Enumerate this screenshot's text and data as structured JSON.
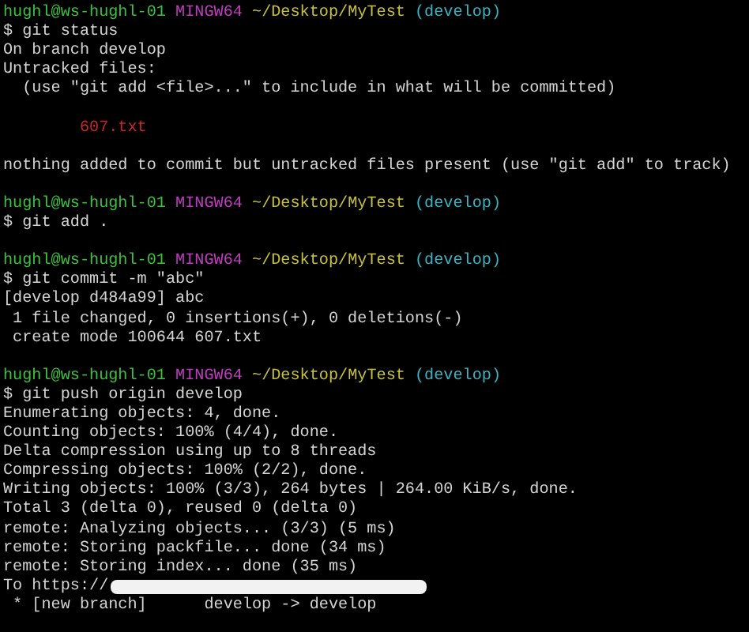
{
  "terminal": {
    "lines": [
      {
        "kind": "prompt",
        "user": "hughl@ws-hughl-01",
        "system": "MINGW64",
        "path": "~/Desktop/MyTest",
        "branch": "(develop)"
      },
      {
        "kind": "command",
        "text": "$ git status"
      },
      {
        "kind": "output",
        "text": "On branch develop"
      },
      {
        "kind": "output",
        "text": "Untracked files:"
      },
      {
        "kind": "output",
        "text": "  (use \"git add <file>...\" to include in what will be committed)"
      },
      {
        "kind": "blank"
      },
      {
        "kind": "file",
        "text": "        607.txt"
      },
      {
        "kind": "blank"
      },
      {
        "kind": "output",
        "text": "nothing added to commit but untracked files present (use \"git add\" to track)"
      },
      {
        "kind": "blank"
      },
      {
        "kind": "prompt",
        "user": "hughl@ws-hughl-01",
        "system": "MINGW64",
        "path": "~/Desktop/MyTest",
        "branch": "(develop)"
      },
      {
        "kind": "command",
        "text": "$ git add ."
      },
      {
        "kind": "blank"
      },
      {
        "kind": "prompt",
        "user": "hughl@ws-hughl-01",
        "system": "MINGW64",
        "path": "~/Desktop/MyTest",
        "branch": "(develop)"
      },
      {
        "kind": "command",
        "text": "$ git commit -m \"abc\""
      },
      {
        "kind": "output",
        "text": "[develop d484a99] abc"
      },
      {
        "kind": "output",
        "text": " 1 file changed, 0 insertions(+), 0 deletions(-)"
      },
      {
        "kind": "output",
        "text": " create mode 100644 607.txt"
      },
      {
        "kind": "blank"
      },
      {
        "kind": "prompt",
        "user": "hughl@ws-hughl-01",
        "system": "MINGW64",
        "path": "~/Desktop/MyTest",
        "branch": "(develop)"
      },
      {
        "kind": "command",
        "text": "$ git push origin develop"
      },
      {
        "kind": "output",
        "text": "Enumerating objects: 4, done."
      },
      {
        "kind": "output",
        "text": "Counting objects: 100% (4/4), done."
      },
      {
        "kind": "output",
        "text": "Delta compression using up to 8 threads"
      },
      {
        "kind": "output",
        "text": "Compressing objects: 100% (2/2), done."
      },
      {
        "kind": "output",
        "text": "Writing objects: 100% (3/3), 264 bytes | 264.00 KiB/s, done."
      },
      {
        "kind": "output",
        "text": "Total 3 (delta 0), reused 0 (delta 0)"
      },
      {
        "kind": "output",
        "text": "remote: Analyzing objects... (3/3) (5 ms)"
      },
      {
        "kind": "output",
        "text": "remote: Storing packfile... done (34 ms)"
      },
      {
        "kind": "output",
        "text": "remote: Storing index... done (35 ms)"
      },
      {
        "kind": "redacted",
        "text": "To https://"
      },
      {
        "kind": "output",
        "text": " * [new branch]      develop -> develop"
      }
    ]
  }
}
